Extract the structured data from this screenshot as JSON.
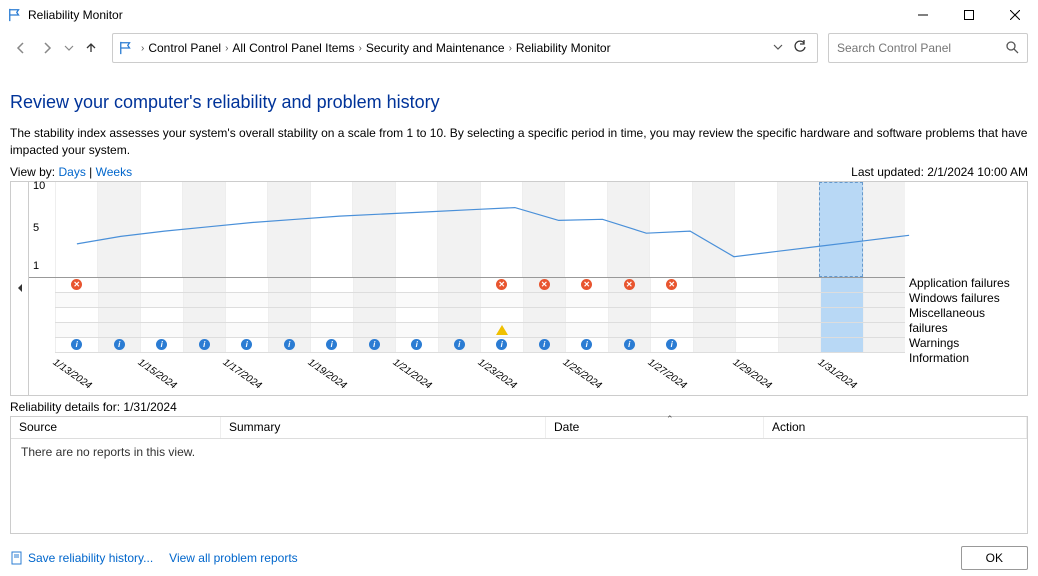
{
  "window": {
    "title": "Reliability Monitor"
  },
  "breadcrumb": {
    "items": [
      "Control Panel",
      "All Control Panel Items",
      "Security and Maintenance",
      "Reliability Monitor"
    ]
  },
  "search": {
    "placeholder": "Search Control Panel"
  },
  "page": {
    "heading": "Review your computer's reliability and problem history",
    "description": "The stability index assesses your system's overall stability on a scale from 1 to 10. By selecting a specific period in time, you may review the specific hardware and software problems that have impacted your system."
  },
  "viewby": {
    "label": "View by:",
    "days": "Days",
    "weeks": "Weeks",
    "last_updated_label": "Last updated:",
    "last_updated_value": "2/1/2024 10:00 AM"
  },
  "chart_data": {
    "type": "line",
    "ylim": [
      1,
      10
    ],
    "yticks": [
      1,
      5,
      10
    ],
    "x_dates": [
      "1/13/2024",
      "",
      "1/15/2024",
      "",
      "1/17/2024",
      "",
      "1/19/2024",
      "",
      "1/21/2024",
      "",
      "1/23/2024",
      "",
      "1/25/2024",
      "",
      "1/27/2024",
      "",
      "1/29/2024",
      "",
      "1/31/2024",
      ""
    ],
    "stability_values": [
      4.2,
      4.9,
      5.4,
      5.8,
      6.2,
      6.5,
      6.8,
      7.0,
      7.2,
      7.4,
      7.6,
      6.4,
      6.5,
      5.2,
      5.4,
      3.0,
      3.5,
      4.0,
      4.5,
      5.0,
      5.3,
      5.5
    ],
    "selected_index": 18,
    "legend": [
      "Application failures",
      "Windows failures",
      "Miscellaneous failures",
      "Warnings",
      "Information"
    ],
    "events": {
      "application_failures": [
        0,
        10,
        11,
        12,
        13,
        14
      ],
      "windows_failures": [],
      "miscellaneous_failures": [],
      "warnings": [
        10
      ],
      "information": [
        0,
        1,
        2,
        3,
        4,
        5,
        6,
        7,
        8,
        9,
        10,
        11,
        12,
        13,
        14
      ]
    }
  },
  "details": {
    "label_prefix": "Reliability details for:",
    "date": "1/31/2024",
    "columns": {
      "source": "Source",
      "summary": "Summary",
      "date": "Date",
      "action": "Action"
    },
    "empty_message": "There are no reports in this view."
  },
  "footer": {
    "save_history": "Save reliability history...",
    "view_all": "View all problem reports",
    "ok": "OK"
  }
}
